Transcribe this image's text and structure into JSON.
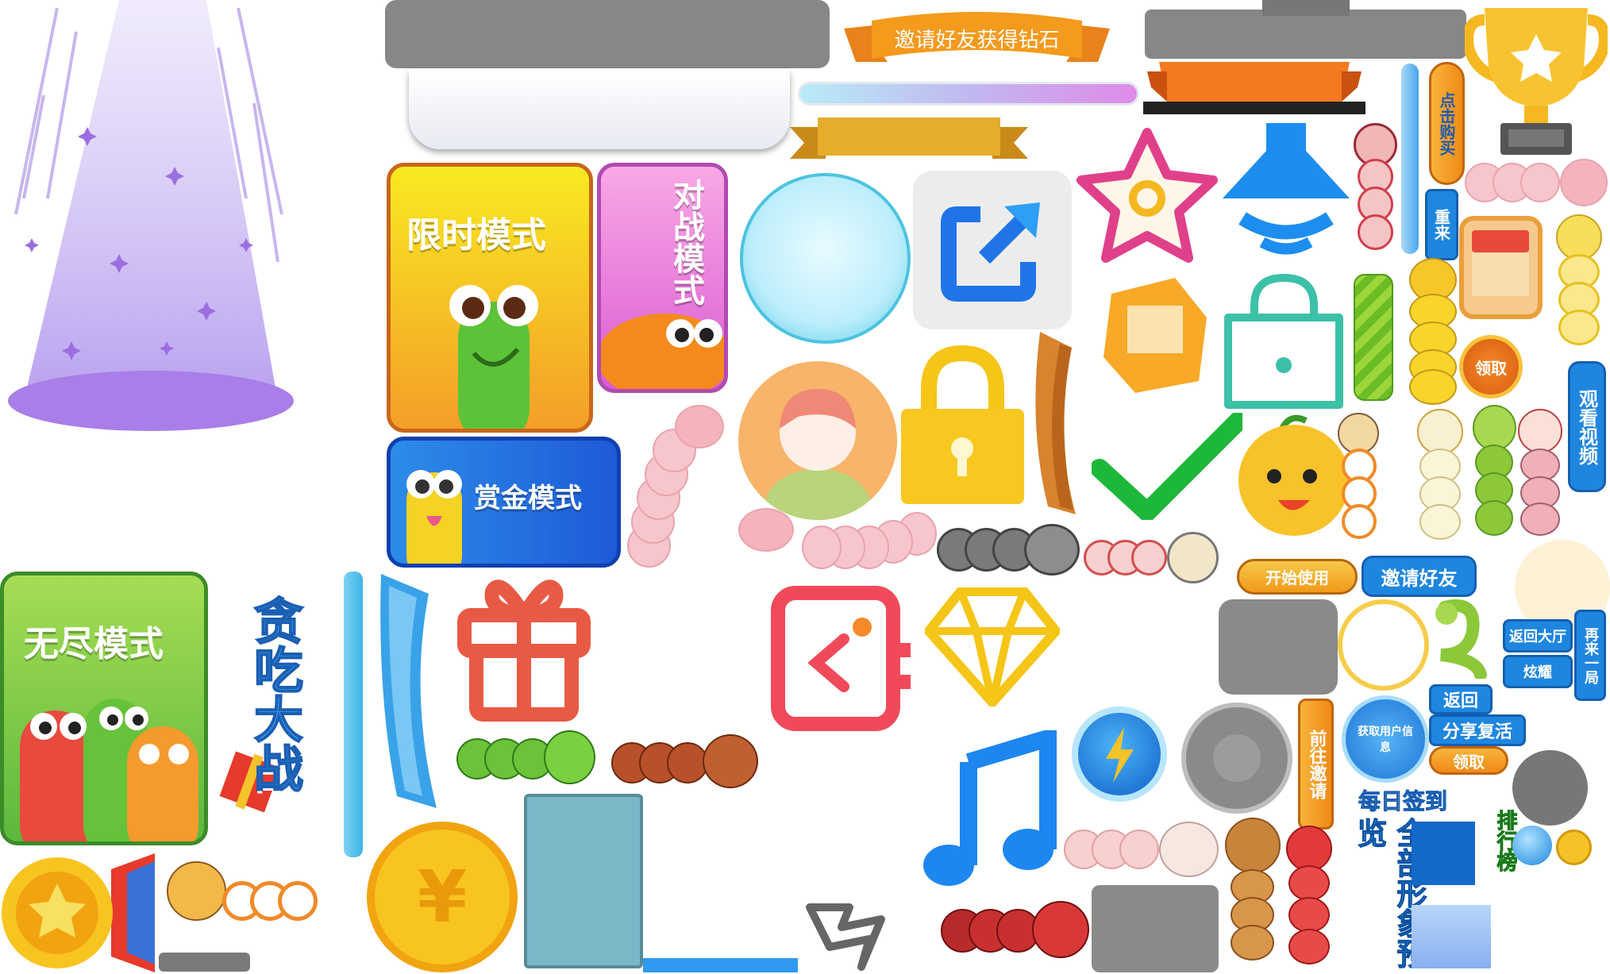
{
  "banner": {
    "invite_diamond": "邀请好友获得钻石"
  },
  "mode_cards": {
    "timed": "限时模式",
    "battle": "对战模式",
    "bounty": "赏金模式",
    "endless": "无尽模式"
  },
  "logo": {
    "title": "贪吃大战"
  },
  "buttons": {
    "click_buy": "点击购买",
    "restart": "重来",
    "watch_video": "观看视频",
    "start_use": "开始使用",
    "invite_friends": "邀请好友",
    "claim_round": "领取",
    "get_user_info": "获取用户信息",
    "go_invite": "前往邀请",
    "back_lobby": "返回大厅",
    "show_off": "炫耀",
    "play_again": "再来一局",
    "back": "返回",
    "share_revive": "分享复活",
    "claim": "领取",
    "daily_checkin": "每日签到",
    "all_skins_preview": "全部形象预览",
    "leaderboard": "排行榜"
  },
  "currency": {
    "yuan_symbol": "¥"
  },
  "colors": {
    "purple_light": "#c8b4f0",
    "gold": "#f5b820",
    "blue_btn": "#1f86e0",
    "orange": "#f47920",
    "green_check": "#1db83a",
    "teal": "#3cc0a8",
    "pink_outline": "#e0408a",
    "gray_panel": "#8a8a8a"
  }
}
